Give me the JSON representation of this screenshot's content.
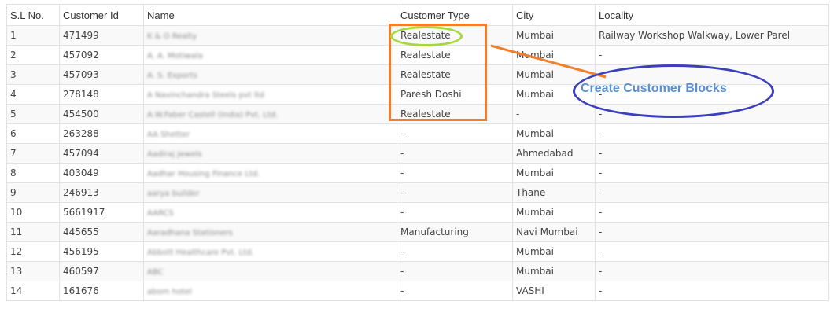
{
  "table": {
    "headers": [
      "S.L No.",
      "Customer Id",
      "Name",
      "Customer Type",
      "City",
      "Locality"
    ],
    "rows": [
      {
        "sl": "1",
        "id": "471499",
        "name": "K & O Realty",
        "type": "Realestate",
        "city": "Mumbai",
        "locality": "Railway Workshop Walkway, Lower Parel"
      },
      {
        "sl": "2",
        "id": "457092",
        "name": "A. A. Motiwala",
        "type": "Realestate",
        "city": "Mumbai",
        "locality": "-"
      },
      {
        "sl": "3",
        "id": "457093",
        "name": "A. S. Exports",
        "type": "Realestate",
        "city": "Mumbai",
        "locality": "-"
      },
      {
        "sl": "4",
        "id": "278148",
        "name": "A Navinchandra Steels pvt ltd",
        "type": "Paresh Doshi",
        "city": "Mumbai",
        "locality": "-"
      },
      {
        "sl": "5",
        "id": "454500",
        "name": "A.W.Faber Castell (India) Pvt. Ltd.",
        "type": "Realestate",
        "city": "-",
        "locality": "-"
      },
      {
        "sl": "6",
        "id": "263288",
        "name": "AA Shetter",
        "type": "-",
        "city": "Mumbai",
        "locality": "-"
      },
      {
        "sl": "7",
        "id": "457094",
        "name": "Aadiraj Jewels",
        "type": "-",
        "city": "Ahmedabad",
        "locality": "-"
      },
      {
        "sl": "8",
        "id": "403049",
        "name": "Aadhar Housing Finance Ltd.",
        "type": "-",
        "city": "Mumbai",
        "locality": "-"
      },
      {
        "sl": "9",
        "id": "246913",
        "name": "aarya builder",
        "type": "-",
        "city": "Thane",
        "locality": "-"
      },
      {
        "sl": "10",
        "id": "5661917",
        "name": "AARCS",
        "type": "-",
        "city": "Mumbai",
        "locality": "-"
      },
      {
        "sl": "11",
        "id": "445655",
        "name": "Aaradhana Stationers",
        "type": "Manufacturing",
        "city": "Navi Mumbai",
        "locality": "-"
      },
      {
        "sl": "12",
        "id": "456195",
        "name": "Abbott Healthcare Pvt. Ltd.",
        "type": "-",
        "city": "Mumbai",
        "locality": "-"
      },
      {
        "sl": "13",
        "id": "460597",
        "name": "ABC",
        "type": "-",
        "city": "Mumbai",
        "locality": "-"
      },
      {
        "sl": "14",
        "id": "161676",
        "name": "abom hotel",
        "type": "-",
        "city": "VASHI",
        "locality": "-"
      }
    ]
  },
  "annotation": {
    "label": "Create Customer Blocks",
    "colors": {
      "box": "#f07e2a",
      "highlight": "#a6d83c",
      "ellipse": "#3b3fbd",
      "label": "#5b8fd1"
    }
  }
}
